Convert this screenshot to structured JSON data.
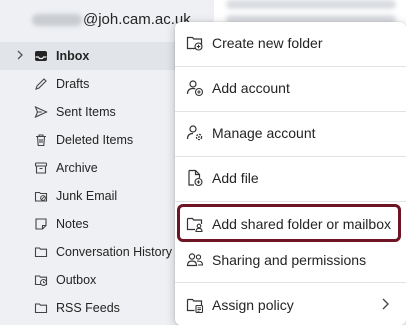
{
  "account": {
    "email_visible": "@joh.cam.ac.uk"
  },
  "folders": [
    {
      "label": "Inbox",
      "icon": "inbox-icon",
      "active": true
    },
    {
      "label": "Drafts",
      "icon": "drafts-icon"
    },
    {
      "label": "Sent Items",
      "icon": "send-icon"
    },
    {
      "label": "Deleted Items",
      "icon": "trash-icon"
    },
    {
      "label": "Archive",
      "icon": "archive-icon"
    },
    {
      "label": "Junk Email",
      "icon": "junk-icon"
    },
    {
      "label": "Notes",
      "icon": "note-icon"
    },
    {
      "label": "Conversation History",
      "icon": "folder-icon"
    },
    {
      "label": "Outbox",
      "icon": "outbox-icon"
    },
    {
      "label": "RSS Feeds",
      "icon": "folder-icon"
    }
  ],
  "menu": {
    "items": [
      {
        "label": "Create new folder",
        "icon": "folder-add-icon"
      },
      {
        "label": "Add account",
        "icon": "person-add-icon"
      },
      {
        "label": "Manage account",
        "icon": "person-settings-icon"
      },
      {
        "label": "Add file",
        "icon": "file-add-icon"
      },
      {
        "label": "Add shared folder or mailbox",
        "icon": "folder-person-icon",
        "highlighted": true
      },
      {
        "label": "Sharing and permissions",
        "icon": "people-icon"
      },
      {
        "label": "Assign policy",
        "icon": "policy-icon",
        "has_submenu": true
      }
    ]
  },
  "colors": {
    "pane_background": "#eef0f3",
    "highlight_border": "#6e1423"
  }
}
